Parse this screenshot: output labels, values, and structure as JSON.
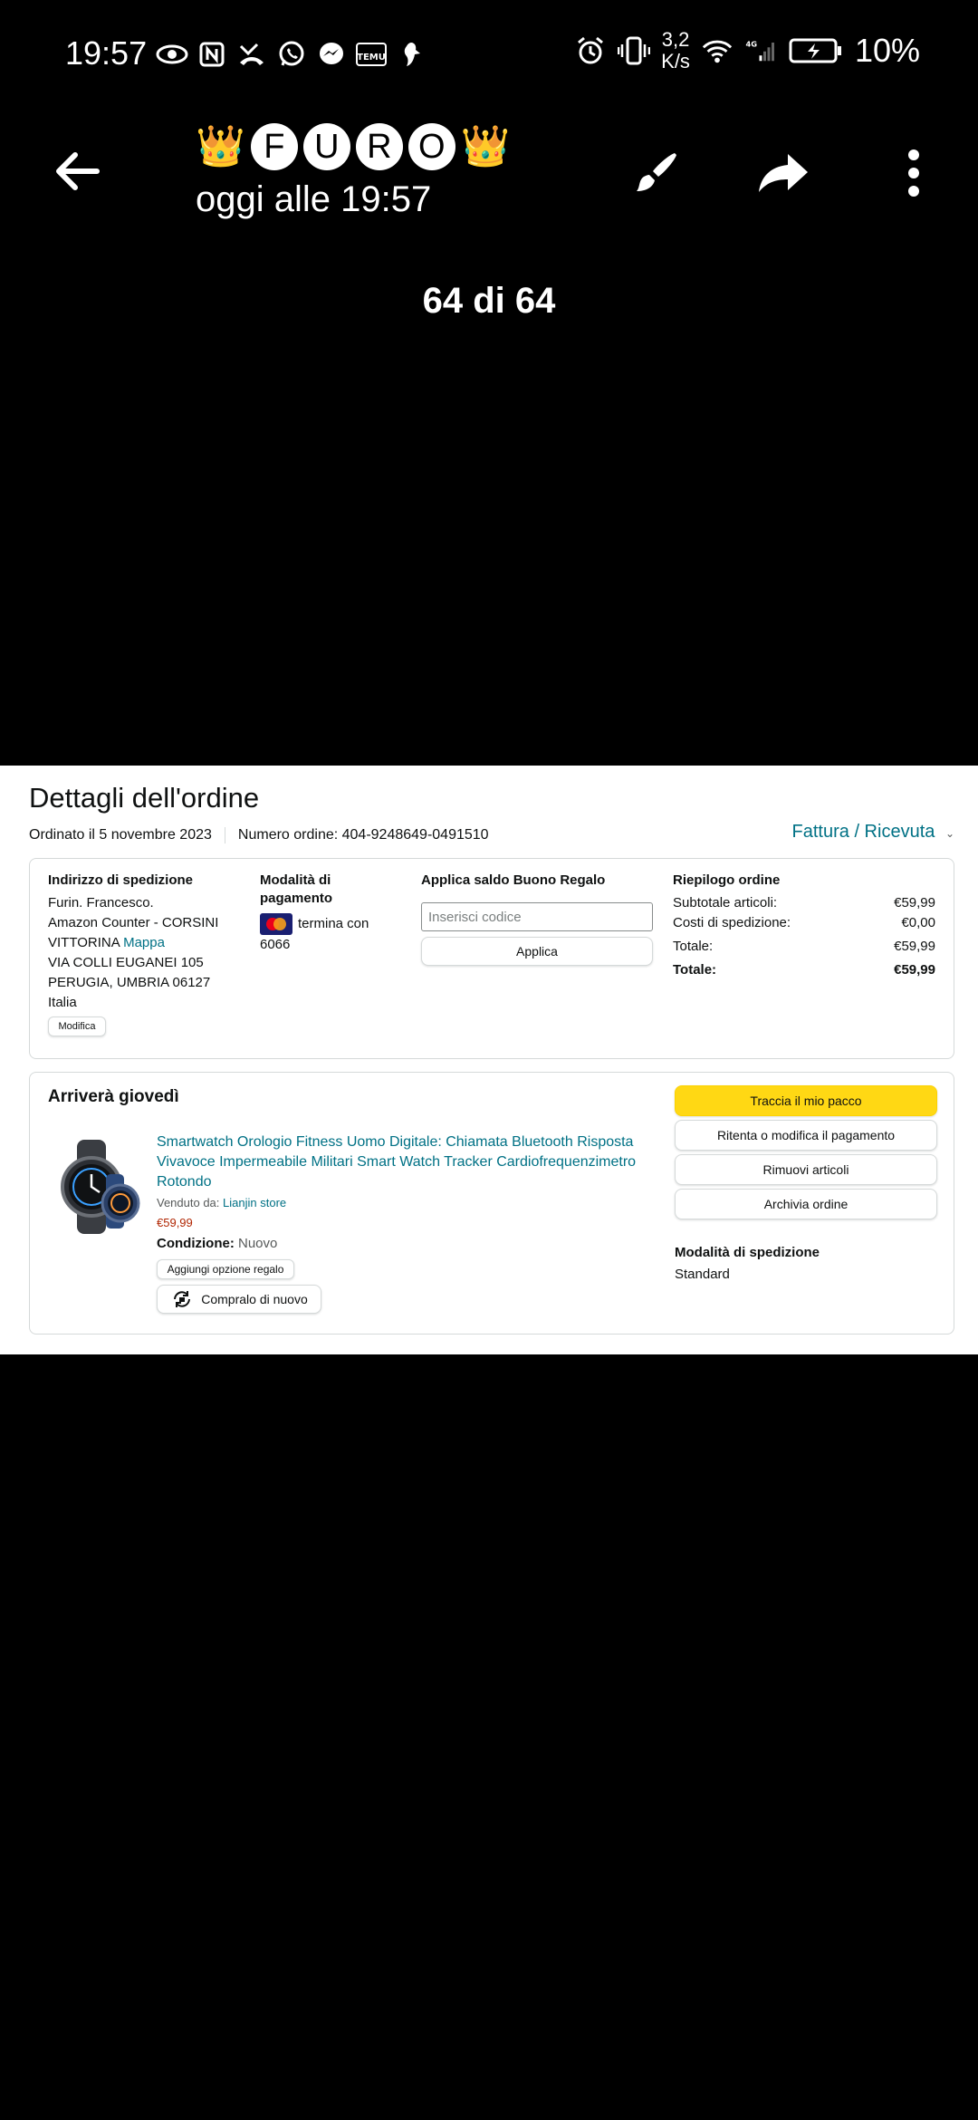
{
  "status_bar": {
    "time": "19:57",
    "left_icons": [
      "eye-icon",
      "nfc-icon",
      "missed-call-icon",
      "whatsapp-icon",
      "messenger-icon",
      "temu-icon",
      "bird-icon"
    ],
    "network_speed_value": "3,2",
    "network_speed_unit": "K/s",
    "network_type": "4G",
    "battery_percent": "10%"
  },
  "viewer": {
    "contact_letters": [
      "F",
      "U",
      "R",
      "O"
    ],
    "contact_decoration": "👑",
    "timestamp": "oggi alle 19:57",
    "counter": "64 di 64",
    "actions": [
      "back-arrow-icon",
      "brush-icon",
      "share-icon",
      "more-vertical-icon"
    ]
  },
  "order": {
    "title": "Dettagli dell'ordine",
    "ordered_on": "Ordinato il 5 novembre 2023",
    "order_number": "Numero ordine: 404-9248649-0491510",
    "invoice_link": "Fattura / Ricevuta",
    "shipping": {
      "heading": "Indirizzo di spedizione",
      "line1": "Furin. Francesco.",
      "line2": "Amazon Counter - CORSINI",
      "line3": "VITTORINA",
      "map_link": "Mappa",
      "line4": "VIA COLLI EUGANEI 105",
      "line5": "PERUGIA, UMBRIA 06127",
      "line6": "Italia",
      "edit_button": "Modifica"
    },
    "payment": {
      "heading_line1": "Modalità di",
      "heading_line2": "pagamento",
      "card_text": "termina con",
      "card_last4": "6066"
    },
    "gift": {
      "heading": "Applica saldo Buono Regalo",
      "placeholder": "Inserisci codice",
      "apply_button": "Applica"
    },
    "summary": {
      "heading": "Riepilogo ordine",
      "rows": [
        {
          "label": "Subtotale articoli:",
          "value": "€59,99"
        },
        {
          "label": "Costi di spedizione:",
          "value": "€0,00"
        },
        {
          "label": "Totale:",
          "value": "€59,99"
        },
        {
          "label": "Totale:",
          "value": "€59,99"
        }
      ]
    },
    "shipment": {
      "heading": "Arriverà giovedì",
      "product_title": "Smartwatch Orologio Fitness Uomo Digitale: Chiamata Bluetooth Risposta Vivavoce Impermeabile Militari Smart Watch Tracker Cardiofrequenzimetro Rotondo",
      "sold_by_label": "Venduto da:",
      "seller": "Lianjin store",
      "price": "€59,99",
      "condition_label": "Condizione:",
      "condition_value": "Nuovo",
      "gift_option_button": "Aggiungi opzione regalo",
      "buy_again_button": "Compralo di nuovo",
      "track_button": "Traccia il mio pacco",
      "retry_payment_button": "Ritenta o modifica il pagamento",
      "remove_button": "Rimuovi articoli",
      "archive_button": "Archivia ordine",
      "shipping_method_heading": "Modalità di spedizione",
      "shipping_method_value": "Standard"
    }
  }
}
